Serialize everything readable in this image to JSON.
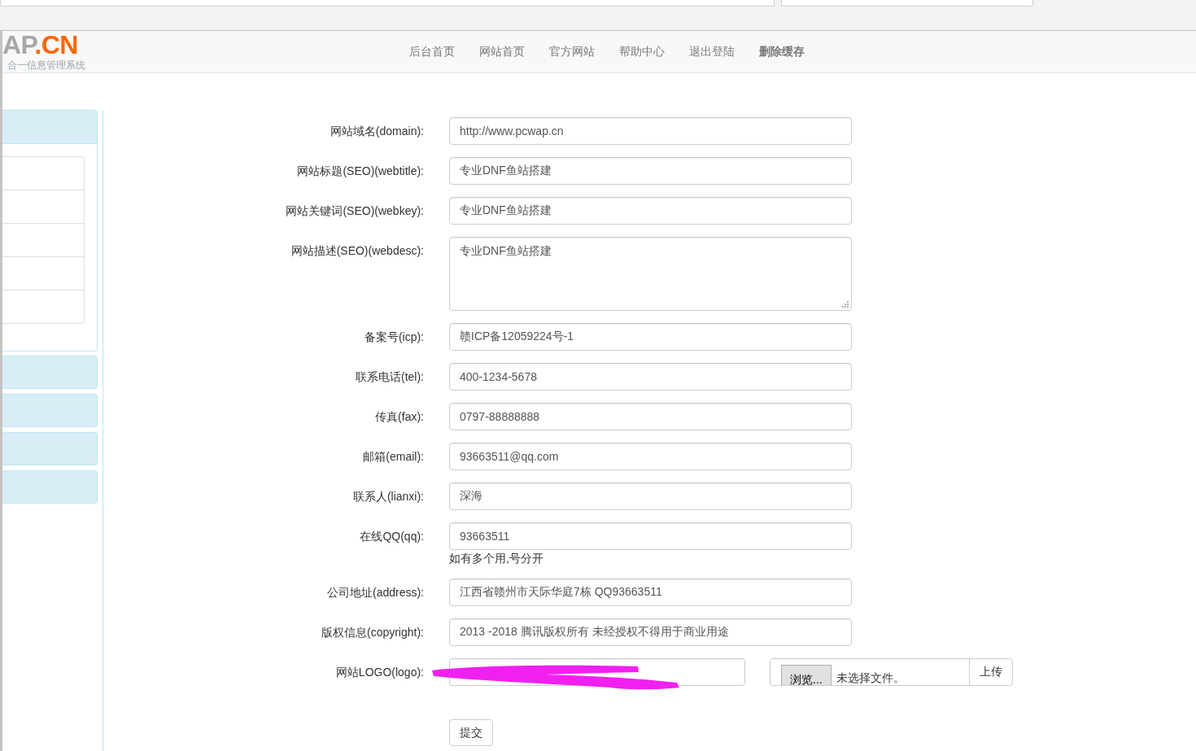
{
  "header": {
    "logo": {
      "text": "AP",
      "accent": ".CN",
      "subtitle": "合一信息管理系统"
    },
    "nav": [
      {
        "label": "后台首页",
        "bold": false
      },
      {
        "label": "网站首页",
        "bold": false
      },
      {
        "label": "官方网站",
        "bold": false
      },
      {
        "label": "帮助中心",
        "bold": false
      },
      {
        "label": "退出登陆",
        "bold": false
      },
      {
        "label": "删除缓存",
        "bold": true
      }
    ]
  },
  "sidebar": {
    "panels": [
      {
        "expanded": true
      },
      {
        "expanded": false
      },
      {
        "expanded": false
      },
      {
        "expanded": false
      },
      {
        "expanded": false
      }
    ]
  },
  "form": {
    "fields": [
      {
        "kind": "input",
        "label": "网站域名(domain):",
        "value": "http://www.pcwap.cn"
      },
      {
        "kind": "input",
        "label": "网站标题(SEO)(webtitle):",
        "value": "专业DNF鱼站搭建"
      },
      {
        "kind": "input",
        "label": "网站关键词(SEO)(webkey):",
        "value": "专业DNF鱼站搭建"
      },
      {
        "kind": "textarea",
        "label": "网站描述(SEO)(webdesc):",
        "value": "专业DNF鱼站搭建"
      },
      {
        "kind": "input",
        "label": "备案号(icp):",
        "value": "赣ICP备12059224号-1"
      },
      {
        "kind": "input",
        "label": "联系电话(tel):",
        "value": "400-1234-5678"
      },
      {
        "kind": "input",
        "label": "传真(fax):",
        "value": "0797-88888888"
      },
      {
        "kind": "input",
        "label": "邮箱(email):",
        "value": "93663511@qq.com"
      },
      {
        "kind": "input",
        "label": "联系人(lianxi):",
        "value": "深海"
      },
      {
        "kind": "input",
        "label": "在线QQ(qq):",
        "value": "93663511",
        "help": "如有多个用,号分开"
      },
      {
        "kind": "input",
        "label": "公司地址(address):",
        "value": "江西省赣州市天际华庭7栋 QQ93663511"
      },
      {
        "kind": "input",
        "label": "版权信息(copyright):",
        "value": "2013 -2018 腾讯版权所有 未经授权不得用于商业用途"
      },
      {
        "kind": "upload",
        "label": "网站LOGO(logo):",
        "redacted": true,
        "browse_button": "浏览...",
        "file_status": "未选择文件。",
        "upload_button": "上传"
      }
    ],
    "submit": "提交"
  }
}
